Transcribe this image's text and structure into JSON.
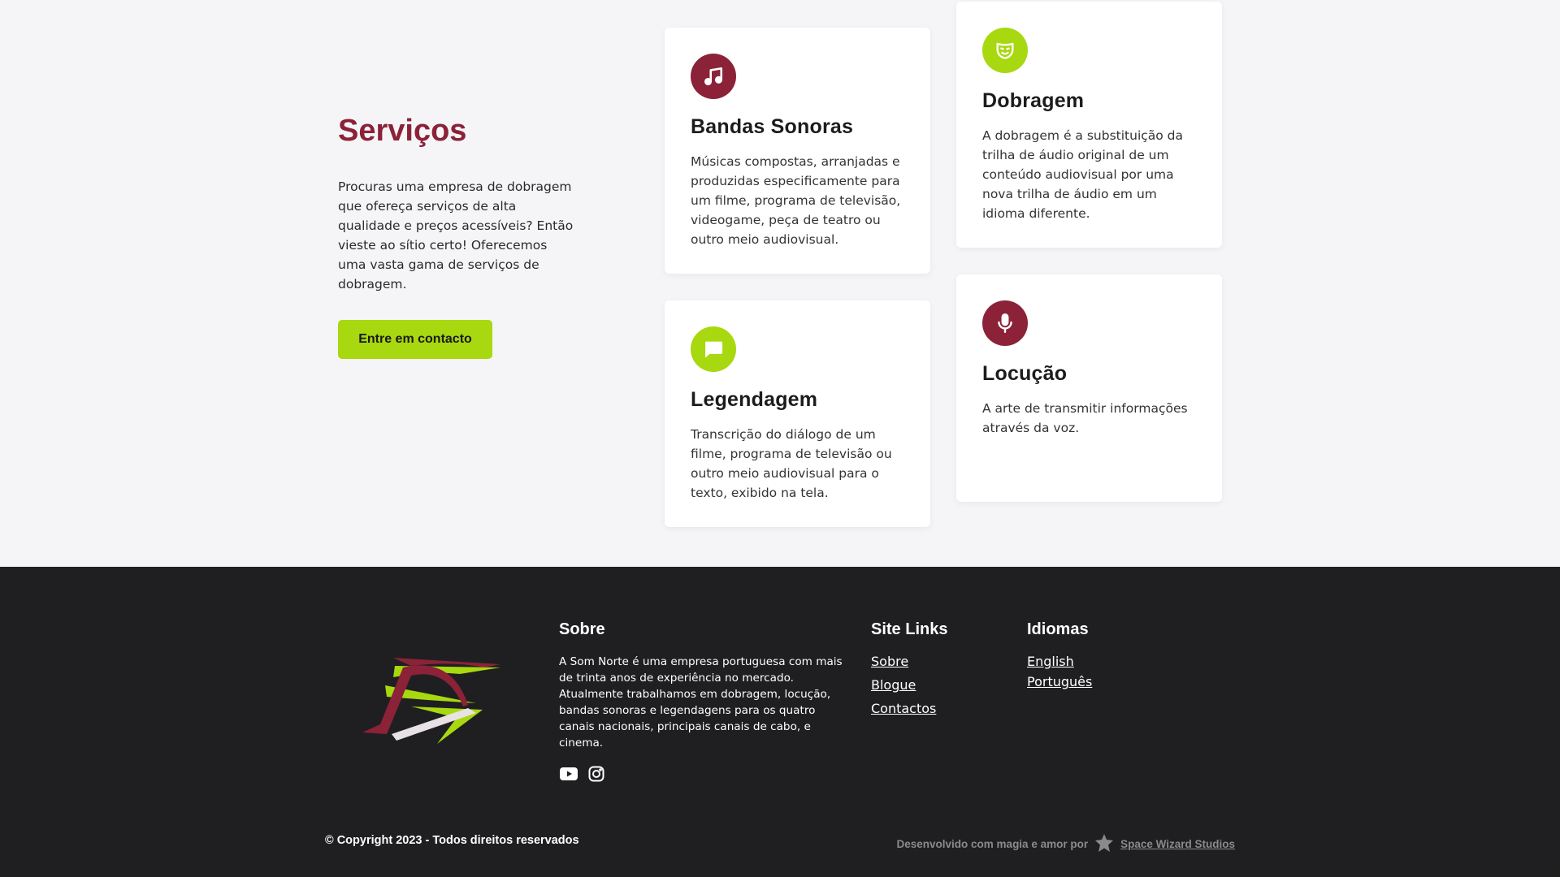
{
  "services": {
    "title": "Serviços",
    "description": "Procuras uma empresa de dobragem que ofereça serviços de alta qualidade e preços acessíveis? Então vieste ao sítio certo! Oferecemos uma vasta gama de serviços de dobragem.",
    "cta_label": "Entre em contacto",
    "cards": [
      {
        "icon": "music-note-icon",
        "title": "Bandas Sonoras",
        "text": "Músicas compostas, arranjadas e produzidas especificamente para um filme, programa de televisão, videogame, peça de teatro ou outro meio audiovisual."
      },
      {
        "icon": "theater-mask-icon",
        "title": "Dobragem",
        "text": "A dobragem é a substituição da trilha de áudio original de um conteúdo audiovisual por uma nova trilha de áudio em um idioma diferente."
      },
      {
        "icon": "chat-bubble-icon",
        "title": "Legendagem",
        "text": "Transcrição do diálogo de um filme, programa de televisão ou outro meio audiovisual para o texto, exibido na tela."
      },
      {
        "icon": "microphone-icon",
        "title": "Locução",
        "text": "A arte de transmitir informações através da voz."
      }
    ]
  },
  "footer": {
    "about": {
      "title": "Sobre",
      "text": "A Som Norte é uma empresa portuguesa com mais de trinta anos de experiência no mercado. Atualmente trabalhamos em dobragem, locução, bandas sonoras e legendagens para os quatro canais nacionais, principais canais de cabo, e cinema."
    },
    "site_links": {
      "title": "Site Links",
      "items": [
        "Sobre",
        "Blogue",
        "Contactos"
      ]
    },
    "languages": {
      "title": "Idiomas",
      "items": [
        "English",
        "Português"
      ]
    },
    "copyright": "© Copyright 2023 - Todos direitos reservados",
    "credit_text": "Desenvolvido com magia e amor por",
    "credit_link": "Space Wizard Studios"
  },
  "colors": {
    "maroon": "#8b2238",
    "lime": "#a8d80f",
    "footer_bg": "#1f1f21",
    "page_bg": "#f5f5f7"
  }
}
